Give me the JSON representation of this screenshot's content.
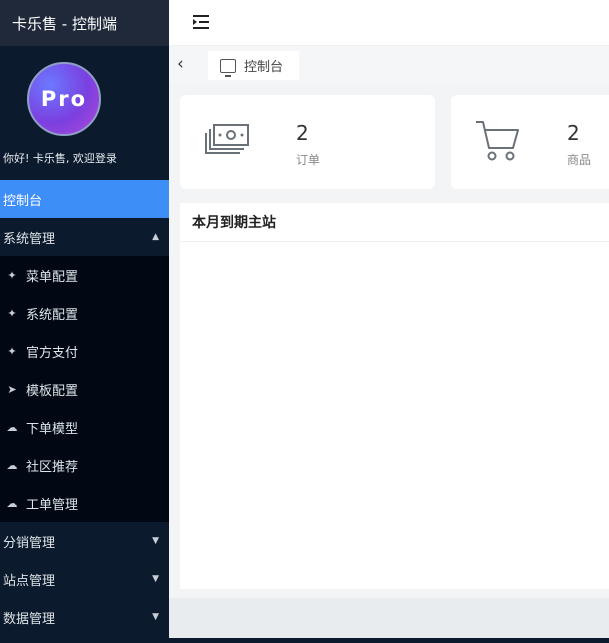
{
  "app": {
    "title": "卡乐售 - 控制端"
  },
  "profile": {
    "avatar_text": "Pro",
    "welcome": "你好! 卡乐售, 欢迎登录"
  },
  "sidebar": {
    "items": [
      {
        "label": "控制台",
        "active": true
      },
      {
        "label": "系统管理",
        "expanded": true,
        "caret": "▲"
      },
      {
        "label": "菜单配置",
        "icon": "tool-icon",
        "glyph": "✦"
      },
      {
        "label": "系统配置",
        "icon": "tool-icon",
        "glyph": "✦"
      },
      {
        "label": "官方支付",
        "icon": "tool-icon",
        "glyph": "✦"
      },
      {
        "label": "模板配置",
        "icon": "send-icon",
        "glyph": "➤"
      },
      {
        "label": "下单模型",
        "icon": "cloud-icon",
        "glyph": "☁"
      },
      {
        "label": "社区推荐",
        "icon": "cloud-icon",
        "glyph": "☁"
      },
      {
        "label": "工单管理",
        "icon": "cloud-icon",
        "glyph": "☁"
      },
      {
        "label": "分销管理",
        "caret": "▼"
      },
      {
        "label": "站点管理",
        "caret": "▼"
      },
      {
        "label": "数据管理",
        "caret": "▼"
      }
    ]
  },
  "tabs": [
    {
      "label": "控制台",
      "icon": "monitor-icon"
    }
  ],
  "stats": [
    {
      "value": "2",
      "label": "订单",
      "icon": "money-icon"
    },
    {
      "value": "2",
      "label": "商品",
      "icon": "cart-icon"
    }
  ],
  "panel": {
    "title": "本月到期主站"
  },
  "colors": {
    "sidebar_bg": "#0b1a2c",
    "active": "#3d8ef7",
    "brand_bg": "#20293a"
  }
}
